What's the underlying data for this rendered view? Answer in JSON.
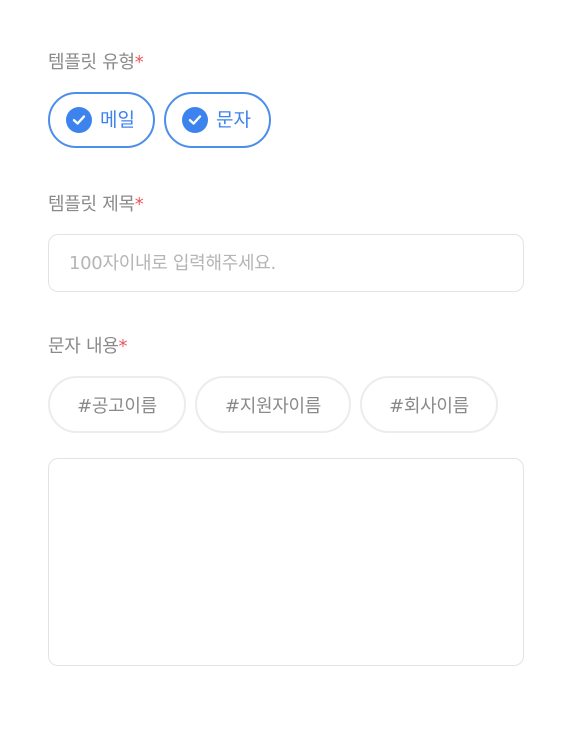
{
  "template_type": {
    "label": "템플릿 유형",
    "required_mark": "*",
    "options": [
      {
        "label": "메일",
        "checked": true
      },
      {
        "label": "문자",
        "checked": true
      }
    ]
  },
  "template_title": {
    "label": "템플릿 제목",
    "required_mark": "*",
    "placeholder": "100자이내로 입력해주세요.",
    "value": ""
  },
  "sms_content": {
    "label": "문자 내용",
    "required_mark": "*",
    "tags": [
      "#공고이름",
      "#지원자이름",
      "#회사이름"
    ],
    "value": ""
  },
  "colors": {
    "accent": "#3d83ee",
    "required": "#f0545c",
    "label_text": "#8a8a8a",
    "border": "#e3e3e3"
  }
}
